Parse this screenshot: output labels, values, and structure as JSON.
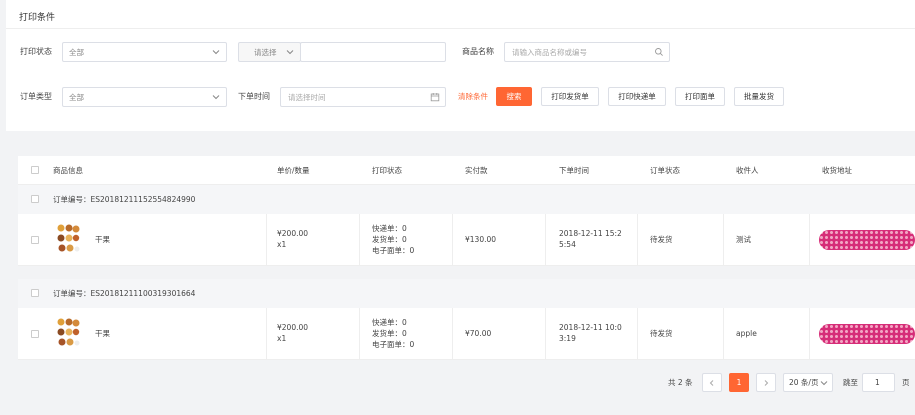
{
  "filter": {
    "title": "打印条件",
    "print_status_label": "打印状态",
    "print_status_value": "全部",
    "query_select_value": "请选择",
    "product_name_label": "商品名称",
    "product_name_placeholder": "请输入商品名称或编号",
    "order_type_label": "订单类型",
    "order_type_value": "全部",
    "order_time_label": "下单时间",
    "order_time_placeholder": "请选择时间",
    "clear_label": "清除条件",
    "search_label": "搜索",
    "print_ship_label": "打印发货单",
    "print_express_label": "打印快递单",
    "print_sheet_label": "打印面单",
    "batch_ship_label": "批量发货"
  },
  "table": {
    "columns": [
      "商品信息",
      "单价/数量",
      "打印状态",
      "实付款",
      "下单时间",
      "订单状态",
      "收件人",
      "收货地址"
    ],
    "orders": [
      {
        "order_no": "订单编号：ES20181211152554824990",
        "product": "干果",
        "price": "¥200.00",
        "qty": "x1",
        "express": "快递单：0",
        "ship": "发货单：0",
        "esheet": "电子面单：0",
        "paid": "¥130.00",
        "time_line1": "2018-12-11 15:2",
        "time_line2": "5:54",
        "status": "待发货",
        "recipient": "测试"
      },
      {
        "order_no": "订单编号：ES20181211100319301664",
        "product": "干果",
        "price": "¥200.00",
        "qty": "x1",
        "express": "快递单：0",
        "ship": "发货单：0",
        "esheet": "电子面单：0",
        "paid": "¥70.00",
        "time_line1": "2018-12-11 10:0",
        "time_line2": "3:19",
        "status": "待发货",
        "recipient": "apple"
      }
    ]
  },
  "pagination": {
    "total": "共 2 条",
    "current_page": "1",
    "page_size": "20 条/页",
    "goto_label": "跳至",
    "goto_value": "1",
    "page_unit": "页"
  },
  "colors": {
    "accent": "#ff6633",
    "address_mask": "#d62d78"
  },
  "icons": [
    "chevron-down-icon",
    "search-icon",
    "calendar-icon",
    "chevron-left-icon",
    "chevron-right-icon",
    "product-thumbnail"
  ]
}
